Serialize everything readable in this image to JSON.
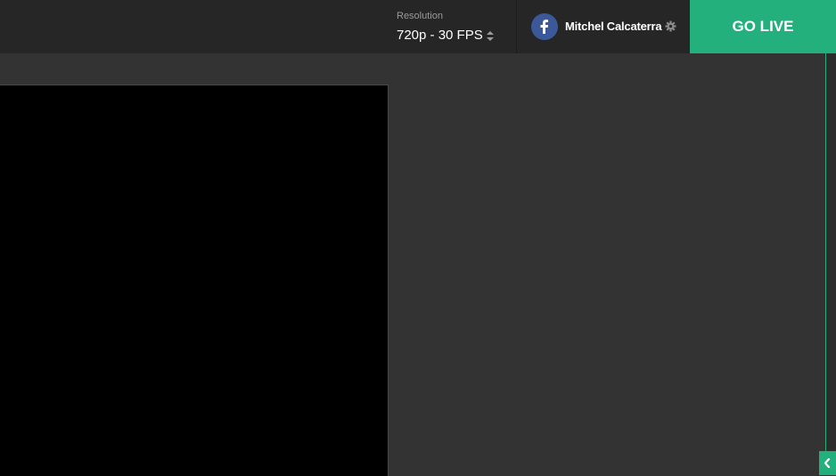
{
  "header": {
    "resolution": {
      "label": "Resolution",
      "value": "720p - 30 FPS",
      "icon": "sort-updown-icon"
    },
    "account": {
      "platform_icon": "facebook-icon",
      "name": "Mitchel Calcaterra",
      "settings_icon": "gear-icon"
    },
    "go_live_label": "GO LIVE"
  },
  "sidebar": {
    "toggle_icon": "chevron-left-icon"
  },
  "colors": {
    "accent": "#23b07d",
    "facebook": "#3b5998",
    "topbar": "#262626",
    "workspace": "#333333",
    "preview": "#000000"
  }
}
